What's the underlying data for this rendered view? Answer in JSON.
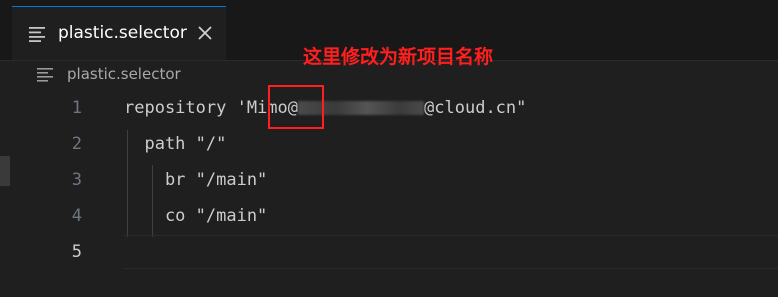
{
  "tab": {
    "label": "plastic.selector",
    "icon": "lines-file-icon",
    "close_icon": "close-icon"
  },
  "breadcrumb": {
    "label": "plastic.selector"
  },
  "annotation": {
    "text": "这里修改为新项目名称",
    "color": "#ff1f1f"
  },
  "editor": {
    "lines": [
      {
        "number": "1",
        "prefix": "repository '",
        "highlight": "Mimo",
        "after_highlight": "@",
        "suffix": "@cloud.cn\""
      },
      {
        "number": "2",
        "text": "  path \"/\""
      },
      {
        "number": "3",
        "text": "    br \"/main\""
      },
      {
        "number": "4",
        "text": "    co \"/main\""
      },
      {
        "number": "5",
        "text": ""
      }
    ],
    "active_line": "5"
  }
}
